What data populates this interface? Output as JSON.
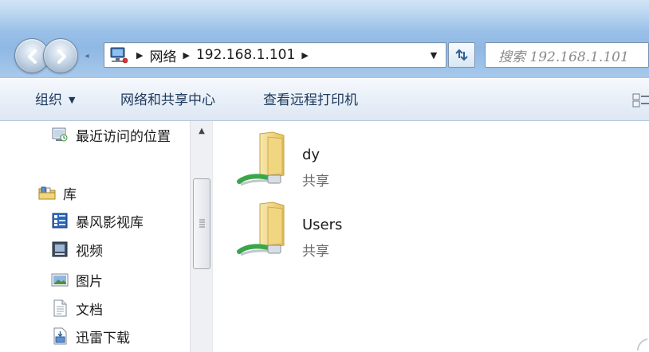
{
  "address": {
    "crumbs": [
      "网络",
      "192.168.1.101"
    ],
    "search_placeholder": "搜索 192.168.1.101"
  },
  "toolbar": {
    "organize_label": "组织",
    "network_center_label": "网络和共享中心",
    "printers_label": "查看远程打印机"
  },
  "sidebar": {
    "recent_label": "最近访问的位置",
    "library_label": "库",
    "items": [
      {
        "label": "暴风影视库",
        "icon": "library-media-icon"
      },
      {
        "label": "视频",
        "icon": "video-icon"
      },
      {
        "label": "图片",
        "icon": "pictures-icon"
      },
      {
        "label": "文档",
        "icon": "documents-icon"
      },
      {
        "label": "迅雷下载",
        "icon": "downloads-icon"
      }
    ]
  },
  "shares": [
    {
      "name": "dy",
      "type": "共享"
    },
    {
      "name": "Users",
      "type": "共享"
    }
  ],
  "colors": {
    "folder": "#f2d77a",
    "share_cable": "#3aa64a",
    "chrome_blue": "#9fc4ea"
  }
}
